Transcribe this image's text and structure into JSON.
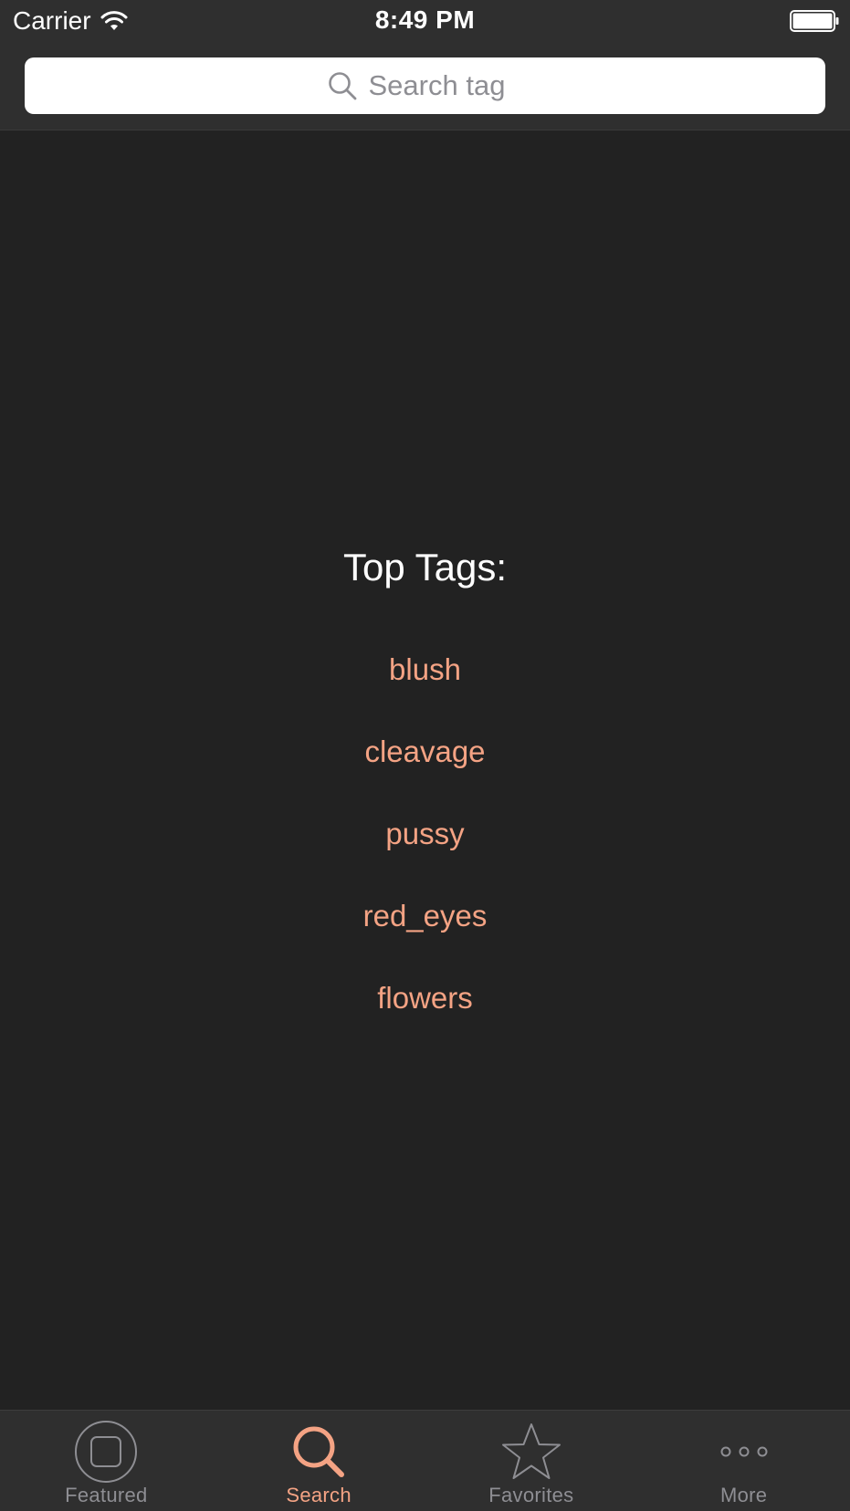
{
  "status_bar": {
    "carrier": "Carrier",
    "time": "8:49 PM",
    "wifi_icon": "wifi-icon",
    "battery_icon": "battery-full-icon"
  },
  "search": {
    "placeholder": "Search tag",
    "value": "",
    "icon": "magnifier-icon"
  },
  "top_tags": {
    "title": "Top Tags:",
    "tags": [
      "blush",
      "cleavage",
      "pussy",
      "red_eyes",
      "flowers"
    ]
  },
  "tab_bar": {
    "tabs": [
      {
        "label": "Featured",
        "icon": "featured-icon",
        "active": false
      },
      {
        "label": "Search",
        "icon": "search-icon",
        "active": true
      },
      {
        "label": "Favorites",
        "icon": "star-icon",
        "active": false
      },
      {
        "label": "More",
        "icon": "more-icon",
        "active": false
      }
    ]
  },
  "colors": {
    "accent": "#f4a384",
    "background": "#222222",
    "bar_background": "#2f2f2f",
    "inactive_tab": "#8e8e93"
  }
}
